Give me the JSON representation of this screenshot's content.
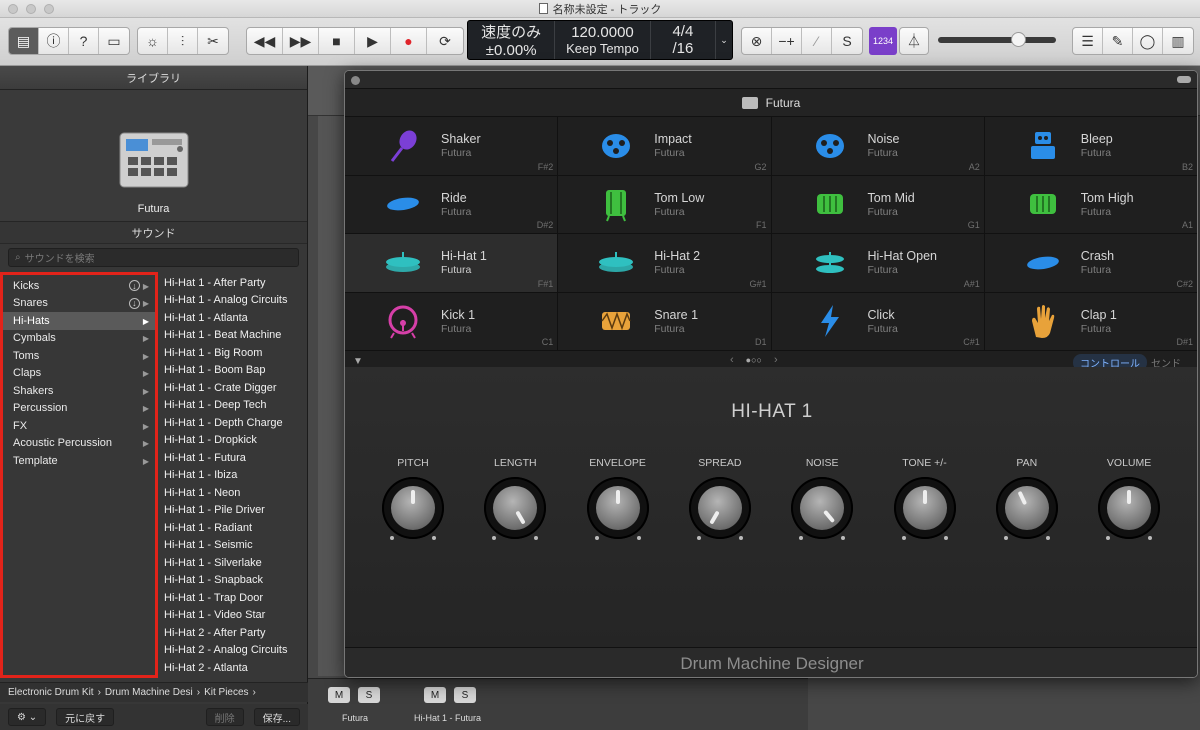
{
  "window": {
    "title": "名称未設定 - トラック"
  },
  "lcd": {
    "speed_label": "速度のみ",
    "speed_value": "±0.00%",
    "tempo": "120.0000",
    "tempo_mode": "Keep Tempo",
    "signature": "4/4",
    "division": "/16"
  },
  "toolbar": {
    "count_in": "1234",
    "accent": "#7a3fc9",
    "master_volume_fraction": 0.68
  },
  "library": {
    "title": "ライブラリ",
    "patch_name": "Futura",
    "sound_header": "サウンド",
    "search_placeholder": "サウンドを検索",
    "categories": [
      {
        "label": "Kicks",
        "download": true
      },
      {
        "label": "Snares",
        "download": true
      },
      {
        "label": "Hi-Hats",
        "selected": true
      },
      {
        "label": "Cymbals"
      },
      {
        "label": "Toms"
      },
      {
        "label": "Claps"
      },
      {
        "label": "Shakers"
      },
      {
        "label": "Percussion"
      },
      {
        "label": "FX"
      },
      {
        "label": "Acoustic Percussion"
      },
      {
        "label": "Template"
      }
    ],
    "items": [
      "Hi-Hat 1 - After Party",
      "Hi-Hat 1 - Analog Circuits",
      "Hi-Hat 1 - Atlanta",
      "Hi-Hat 1 - Beat Machine",
      "Hi-Hat 1 - Big Room",
      "Hi-Hat 1 - Boom Bap",
      "Hi-Hat 1 - Crate Digger",
      "Hi-Hat 1 - Deep Tech",
      "Hi-Hat 1 - Depth Charge",
      "Hi-Hat 1 - Dropkick",
      "Hi-Hat 1 - Futura",
      "Hi-Hat 1 - Ibiza",
      "Hi-Hat 1 - Neon",
      "Hi-Hat 1 - Pile Driver",
      "Hi-Hat 1 - Radiant",
      "Hi-Hat 1 - Seismic",
      "Hi-Hat 1 - Silverlake",
      "Hi-Hat 1 - Snapback",
      "Hi-Hat 1 - Trap Door",
      "Hi-Hat 1 - Video Star",
      "Hi-Hat 2 - After Party",
      "Hi-Hat 2 - Analog Circuits",
      "Hi-Hat 2 - Atlanta"
    ],
    "path": [
      "Electronic Drum Kit",
      "Drum Machine Desi",
      "Kit Pieces"
    ],
    "revert_label": "元に戻す",
    "delete_label": "削除",
    "save_label": "保存..."
  },
  "mixer": {
    "mute": "M",
    "solo": "S",
    "channels": [
      "Futura",
      "Hi-Hat 1 - Futura"
    ]
  },
  "plugin": {
    "kit_name": "Futura",
    "pads": [
      {
        "name": "Shaker",
        "kit": "Futura",
        "note": "F#2",
        "icon": "shaker-icon",
        "color": "#7b3fd6"
      },
      {
        "name": "Impact",
        "kit": "Futura",
        "note": "G2",
        "icon": "impact-icon",
        "color": "#2a8de8"
      },
      {
        "name": "Noise",
        "kit": "Futura",
        "note": "A2",
        "icon": "noise-icon",
        "color": "#2a8de8"
      },
      {
        "name": "Bleep",
        "kit": "Futura",
        "note": "B2",
        "icon": "robot-icon",
        "color": "#2a8de8"
      },
      {
        "name": "Ride",
        "kit": "Futura",
        "note": "D#2",
        "icon": "ride-cymbal-icon",
        "color": "#2a8de8"
      },
      {
        "name": "Tom Low",
        "kit": "Futura",
        "note": "F1",
        "icon": "tom-low-icon",
        "color": "#3fbf3f"
      },
      {
        "name": "Tom Mid",
        "kit": "Futura",
        "note": "G1",
        "icon": "tom-mid-icon",
        "color": "#3fbf3f"
      },
      {
        "name": "Tom High",
        "kit": "Futura",
        "note": "A1",
        "icon": "tom-high-icon",
        "color": "#3fbf3f"
      },
      {
        "name": "Hi-Hat 1",
        "kit": "Futura",
        "note": "F#1",
        "icon": "hihat-icon",
        "color": "#2fc0c0",
        "selected": true
      },
      {
        "name": "Hi-Hat 2",
        "kit": "Futura",
        "note": "G#1",
        "icon": "hihat-icon",
        "color": "#2fc0c0"
      },
      {
        "name": "Hi-Hat Open",
        "kit": "Futura",
        "note": "A#1",
        "icon": "hihat-open-icon",
        "color": "#2fc0c0"
      },
      {
        "name": "Crash",
        "kit": "Futura",
        "note": "C#2",
        "icon": "crash-cymbal-icon",
        "color": "#2a8de8"
      },
      {
        "name": "Kick 1",
        "kit": "Futura",
        "note": "C1",
        "icon": "kick-drum-icon",
        "color": "#d63fa8"
      },
      {
        "name": "Snare 1",
        "kit": "Futura",
        "note": "D1",
        "icon": "snare-drum-icon",
        "color": "#e8a23a"
      },
      {
        "name": "Click",
        "kit": "Futura",
        "note": "C#1",
        "icon": "lightning-icon",
        "color": "#2a8de8"
      },
      {
        "name": "Clap 1",
        "kit": "Futura",
        "note": "D#1",
        "icon": "hand-icon",
        "color": "#e8a23a"
      }
    ],
    "tab_controls": "コントロール",
    "tab_send": "センド",
    "instrument_title": "HI-HAT 1",
    "knobs": [
      {
        "label": "PITCH",
        "angle": 0
      },
      {
        "label": "LENGTH",
        "angle": 150
      },
      {
        "label": "ENVELOPE",
        "angle": 0
      },
      {
        "label": "SPREAD",
        "angle": -150
      },
      {
        "label": "NOISE",
        "angle": 140
      },
      {
        "label": "TONE +/-",
        "angle": 0
      },
      {
        "label": "PAN",
        "angle": -25
      },
      {
        "label": "VOLUME",
        "angle": 0
      }
    ],
    "footer": "Drum Machine Designer"
  }
}
